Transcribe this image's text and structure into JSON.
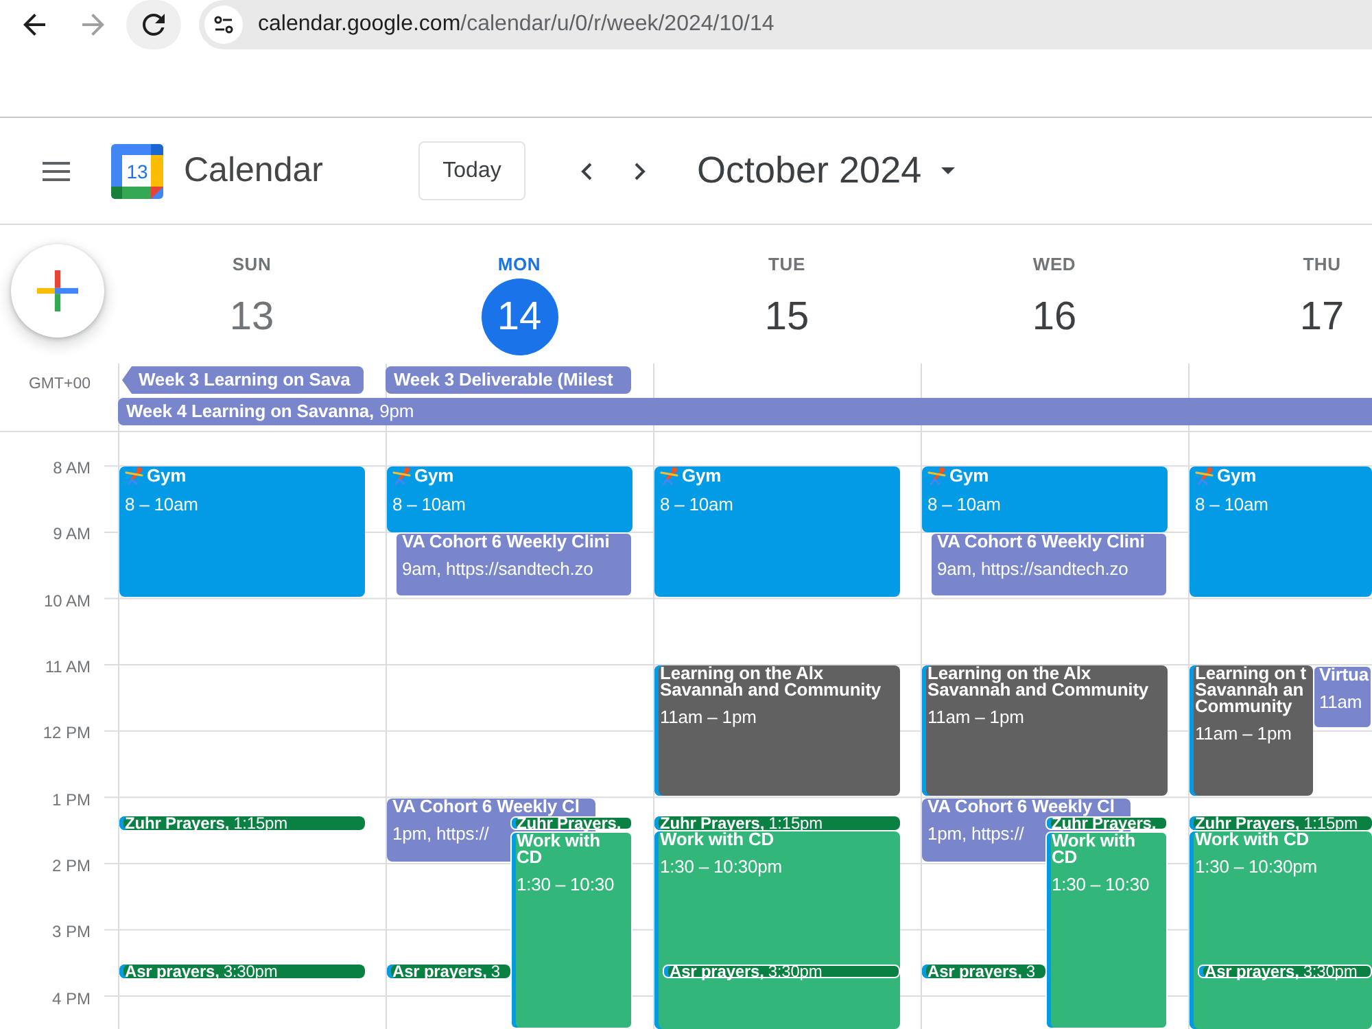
{
  "browser": {
    "url_host": "calendar.google.com",
    "url_path": "/calendar/u/0/r/week/2024/10/14",
    "forward_disabled": true
  },
  "header": {
    "logo_day": "13",
    "title": "Calendar",
    "today_button": "Today",
    "period": "October 2024"
  },
  "days": [
    {
      "name": "SUN",
      "date": "13",
      "today": false,
      "past": true,
      "events": [
        {
          "kind": "timed",
          "title": "Gym",
          "time": "8 – 10am",
          "color": "#039be5",
          "stripe": false,
          "icon": true
        },
        {
          "kind": "short",
          "title": "Zuhr Prayers,",
          "time": "1:15pm",
          "color": "#0b8043",
          "stripe": true,
          "icon": false
        },
        {
          "kind": "short",
          "title": "Asr prayers,",
          "time": "3:30pm",
          "color": "#0b8043",
          "stripe": true,
          "icon": false
        }
      ]
    },
    {
      "name": "MON",
      "date": "14",
      "today": true,
      "past": false,
      "events": [
        {
          "kind": "timed",
          "title": "Gym",
          "time": "8 – 10am",
          "color": "#039be5",
          "stripe": false,
          "icon": true
        },
        {
          "kind": "timed",
          "title": "VA Cohort 6 Weekly Clini",
          "time": "9am, https://sandtech.zo",
          "color": "#7986cb",
          "stripe": false,
          "icon": false
        },
        {
          "kind": "timed",
          "title": "VA Cohort 6 Weekly Cl",
          "time": "1pm, https://",
          "color": "#7986cb",
          "stripe": false,
          "icon": false
        },
        {
          "kind": "short",
          "title": "Zuhr Prayers,",
          "color": "#0b8043",
          "stripe": true,
          "icon": false
        },
        {
          "kind": "timed",
          "title": "Work with\nCD",
          "time": "1:30 – 10:30",
          "color": "#33b679",
          "stripe": true,
          "icon": false
        },
        {
          "kind": "short",
          "title": "Asr prayers,",
          "time": "3",
          "color": "#0b8043",
          "stripe": true,
          "icon": false
        }
      ]
    },
    {
      "name": "TUE",
      "date": "15",
      "today": false,
      "past": false,
      "events": [
        {
          "kind": "timed",
          "title": "Gym",
          "time": "8 – 10am",
          "color": "#039be5",
          "stripe": false,
          "icon": true
        },
        {
          "kind": "timed",
          "title": "Learning on the Alx\nSavannah and Community",
          "time": "11am – 1pm",
          "color": "#616161",
          "stripe": true,
          "icon": false
        },
        {
          "kind": "short",
          "title": "Zuhr Prayers,",
          "time": "1:15pm",
          "color": "#0b8043",
          "stripe": true,
          "icon": false
        },
        {
          "kind": "timed",
          "title": "Work with CD",
          "time": "1:30 – 10:30pm",
          "color": "#33b679",
          "stripe": true,
          "icon": false
        },
        {
          "kind": "short",
          "title": "Asr prayers,",
          "time": "3:30pm",
          "color": "#0b8043",
          "stripe": true,
          "icon": false
        }
      ]
    },
    {
      "name": "WED",
      "date": "16",
      "today": false,
      "past": false,
      "events": [
        {
          "kind": "timed",
          "title": "Gym",
          "time": "8 – 10am",
          "color": "#039be5",
          "stripe": false,
          "icon": true
        },
        {
          "kind": "timed",
          "title": "VA Cohort 6 Weekly Clini",
          "time": "9am, https://sandtech.zo",
          "color": "#7986cb",
          "stripe": false,
          "icon": false
        },
        {
          "kind": "timed",
          "title": "Learning on the Alx\nSavannah and Community",
          "time": "11am – 1pm",
          "color": "#616161",
          "stripe": true,
          "icon": false
        },
        {
          "kind": "timed",
          "title": "VA Cohort 6 Weekly Cl",
          "time": "1pm, https://",
          "color": "#7986cb",
          "stripe": false,
          "icon": false
        },
        {
          "kind": "short",
          "title": "Zuhr Prayers,",
          "color": "#0b8043",
          "stripe": true,
          "icon": false
        },
        {
          "kind": "timed",
          "title": "Work with\nCD",
          "time": "1:30 – 10:30",
          "color": "#33b679",
          "stripe": true,
          "icon": false
        },
        {
          "kind": "short",
          "title": "Asr prayers,",
          "time": "3",
          "color": "#0b8043",
          "stripe": true,
          "icon": false
        }
      ]
    },
    {
      "name": "THU",
      "date": "17",
      "today": false,
      "past": false,
      "events": [
        {
          "kind": "timed",
          "title": "Gym",
          "time": "8 – 10am",
          "color": "#039be5",
          "stripe": false,
          "icon": true
        },
        {
          "kind": "timed",
          "title": "Learning on t\nSavannah an\nCommunity",
          "time": "11am – 1pm",
          "color": "#616161",
          "stripe": true,
          "icon": false
        },
        {
          "kind": "timed",
          "title": "Virtua",
          "time": "11am",
          "color": "#7986cb",
          "stripe": false,
          "icon": false
        },
        {
          "kind": "short",
          "title": "Zuhr Prayers,",
          "time": "1:15pm",
          "color": "#0b8043",
          "stripe": true,
          "icon": false
        },
        {
          "kind": "timed",
          "title": "Work with CD",
          "time": "1:30 – 10:30pm",
          "color": "#33b679",
          "stripe": true,
          "icon": false
        },
        {
          "kind": "short",
          "title": "Asr prayers,",
          "time": "3:30pm",
          "color": "#0b8043",
          "stripe": true,
          "icon": false
        }
      ]
    }
  ],
  "all_day": {
    "timezone": "GMT+00",
    "rows": [
      [
        {
          "title": "Week 3 Learning on Sava",
          "continued": true,
          "to_end": false
        },
        {
          "title": "Week 3 Deliverable (Milest",
          "continued": false,
          "to_end": false
        }
      ],
      [
        {
          "title": "Week 4 Learning on Savanna,",
          "time": "9pm",
          "continued": false,
          "to_end": true
        }
      ]
    ]
  },
  "hours": [
    "8 AM",
    "9 AM",
    "10 AM",
    "11 AM",
    "12 PM",
    "1 PM",
    "2 PM",
    "3 PM",
    "4 PM"
  ]
}
